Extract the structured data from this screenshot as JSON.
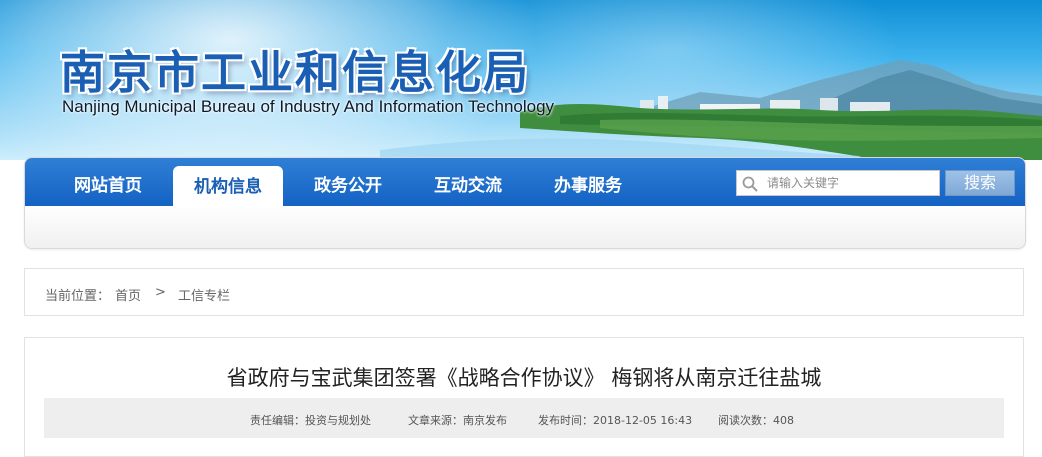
{
  "header": {
    "title_cn": "南京市工业和信息化局",
    "title_en": "Nanjing Municipal Bureau of Industry And Information Technology"
  },
  "nav": {
    "items": [
      {
        "label": "网站首页",
        "active": false
      },
      {
        "label": "机构信息",
        "active": true
      },
      {
        "label": "政务公开",
        "active": false
      },
      {
        "label": "互动交流",
        "active": false
      },
      {
        "label": "办事服务",
        "active": false
      }
    ]
  },
  "search": {
    "placeholder": "请输入关键字",
    "button_label": "搜索",
    "icon": "search-icon"
  },
  "breadcrumb": {
    "prefix": "当前位置：",
    "home": "首页",
    "separator": ">",
    "current": "工信专栏"
  },
  "article": {
    "title": "省政府与宝武集团签署《战略合作协议》 梅钢将从南京迁往盐城",
    "editor": "责任编辑：投资与规划处",
    "source": "文章来源：南京发布",
    "time": "发布时间：2018-12-05 16:43",
    "views": "阅读次数：408"
  },
  "colors": {
    "nav_blue": "#1462c3",
    "title_blue": "#1a5fb4",
    "search_button": "#8fb4de"
  }
}
